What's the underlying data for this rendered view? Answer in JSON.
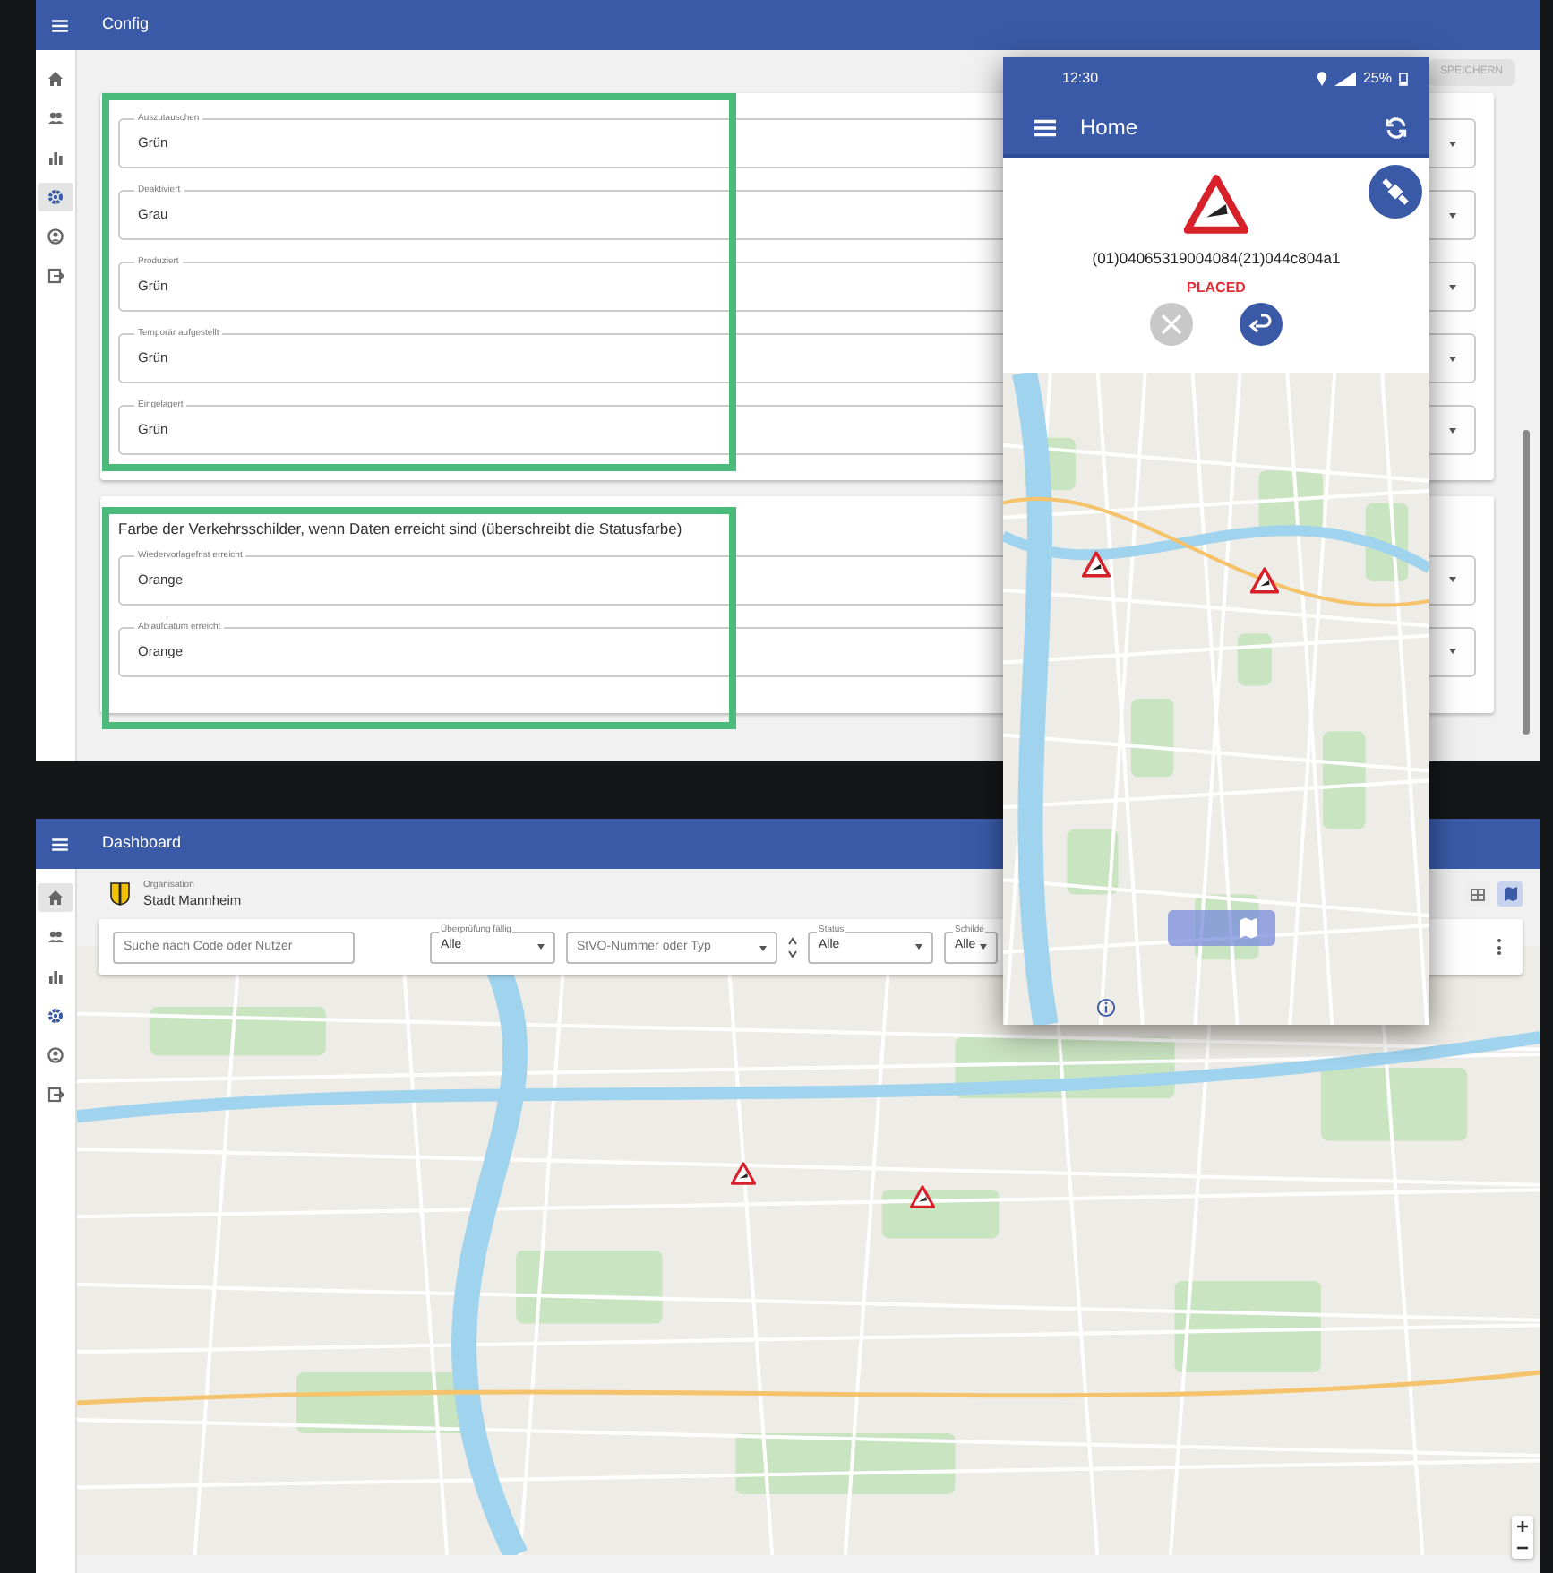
{
  "config_window": {
    "title": "Config",
    "sidebar": [
      {
        "kind": "home",
        "selected": false
      },
      {
        "kind": "people",
        "selected": false
      },
      {
        "kind": "chart",
        "selected": false
      },
      {
        "kind": "gear",
        "selected": true
      },
      {
        "kind": "account",
        "selected": false
      },
      {
        "kind": "logout",
        "selected": false
      }
    ],
    "save_button": {
      "label": "SPEICHERN",
      "disabled": true
    },
    "status_fields": [
      {
        "label": "Auszutauschen",
        "value": "Grün"
      },
      {
        "label": "Deaktiviert",
        "value": "Grau"
      },
      {
        "label": "Produziert",
        "value": "Grün"
      },
      {
        "label": "Temporär aufgestellt",
        "value": "Grün"
      },
      {
        "label": "Eingelagert",
        "value": "Grün"
      }
    ],
    "date_section": {
      "heading": "Farbe der Verkehrsschilder, wenn Daten erreicht sind (überschreibt die Statusfarbe)",
      "fields": [
        {
          "label": "Wiedervorlagefrist erreicht",
          "value": "Orange"
        },
        {
          "label": "Ablaufdatum erreicht",
          "value": "Orange"
        }
      ]
    }
  },
  "phone": {
    "status_time": "12:30",
    "battery": "25%",
    "title": "Home",
    "code": "(01)04065319004084(21)044c804a1",
    "status": "PLACED",
    "dismiss_disabled": true
  },
  "dashboard_window": {
    "title": "Dashboard",
    "sidebar": [
      {
        "kind": "home",
        "selected": true
      },
      {
        "kind": "people",
        "selected": false
      },
      {
        "kind": "chart",
        "selected": false
      },
      {
        "kind": "gear",
        "selected": false
      },
      {
        "kind": "account",
        "selected": false
      },
      {
        "kind": "logout",
        "selected": false
      }
    ],
    "organisation_label": "Organisation",
    "organisation": "Stadt Mannheim",
    "search": {
      "placeholder": "Suche nach Code oder Nutzer"
    },
    "filters": [
      {
        "kind": "select",
        "label": "Überprüfung fällig",
        "value": "Alle"
      },
      {
        "kind": "combo",
        "placeholder": "StVO-Nummer oder Typ"
      },
      {
        "kind": "select",
        "label": "Status",
        "value": "Alle"
      },
      {
        "kind": "select",
        "label": "Schilde",
        "value": "Alle"
      }
    ],
    "views": [
      {
        "kind": "table",
        "selected": false
      },
      {
        "kind": "map",
        "selected": true
      }
    ]
  }
}
